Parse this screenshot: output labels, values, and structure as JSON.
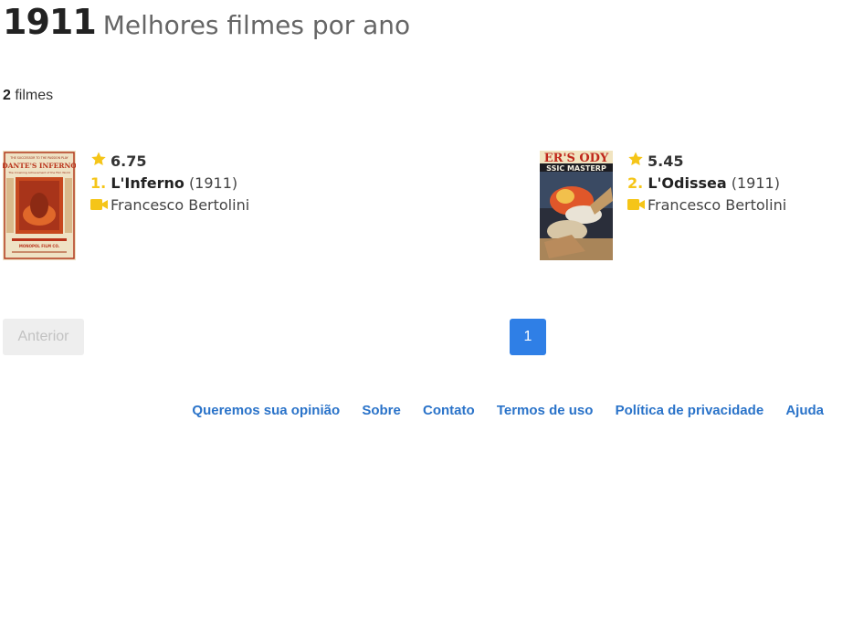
{
  "header": {
    "year": "1911",
    "subtitle": "Melhores filmes por ano"
  },
  "summary": {
    "count": "2",
    "count_label": "filmes"
  },
  "movies": [
    {
      "rating": "6.75",
      "rank": "1.",
      "title": "L'Inferno",
      "year": "(1911)",
      "director": "Francesco Bertolini",
      "poster": {
        "line1": "THE SUCCESSOR TO THE PASSION PLAY",
        "line2": "DANTE'S INFERNO",
        "line3": "The Crowning Achievement of the Film World",
        "line4": "MONOPOL FILM CO."
      }
    },
    {
      "rating": "5.45",
      "rank": "2.",
      "title": "L'Odissea",
      "year": "(1911)",
      "director": "Francesco Bertolini",
      "poster": {
        "line1": "ER'S ODY",
        "line2": "SSIC MASTERP"
      }
    }
  ],
  "pagination": {
    "prev_label": "Anterior",
    "current_page": "1"
  },
  "footer": {
    "links": [
      "Queremos sua opinião",
      "Sobre",
      "Contato",
      "Termos de uso",
      "Política de privacidade",
      "Ajuda"
    ]
  },
  "colors": {
    "accent_star": "#f5c518",
    "page_active": "#2f7fe6",
    "link": "#2a73c9"
  }
}
